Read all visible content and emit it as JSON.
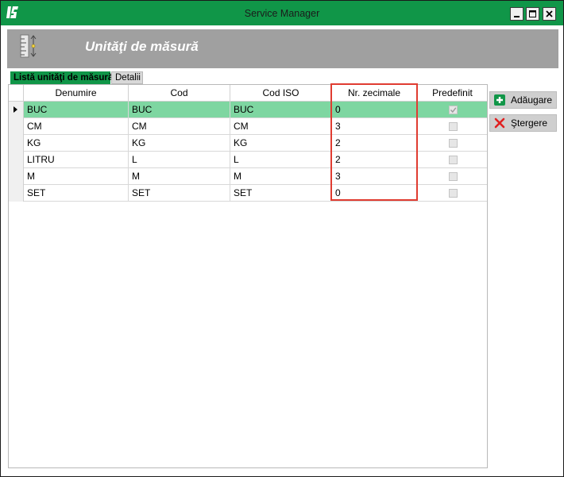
{
  "window": {
    "title": "Service Manager",
    "logo_text": "SM",
    "accent_color": "#109648",
    "selected_row_color": "#7ed6a1",
    "highlight_color": "#e03c31"
  },
  "header": {
    "title": "Unităţi de măsură",
    "icon": "ruler-icon"
  },
  "tabs": [
    {
      "label": "Listă unităţi de măsură",
      "active": true
    },
    {
      "label": "Detalii",
      "active": false
    }
  ],
  "grid": {
    "columns": [
      "Denumire",
      "Cod",
      "Cod ISO",
      "Nr. zecimale",
      "Predefinit"
    ],
    "rows": [
      {
        "denumire": "BUC",
        "cod": "BUC",
        "cod_iso": "BUC",
        "zecimale": "0",
        "predefinit": true,
        "selected": true
      },
      {
        "denumire": "CM",
        "cod": "CM",
        "cod_iso": "CM",
        "zecimale": "3",
        "predefinit": false,
        "selected": false
      },
      {
        "denumire": "KG",
        "cod": "KG",
        "cod_iso": "KG",
        "zecimale": "2",
        "predefinit": false,
        "selected": false
      },
      {
        "denumire": "LITRU",
        "cod": "L",
        "cod_iso": "L",
        "zecimale": "2",
        "predefinit": false,
        "selected": false
      },
      {
        "denumire": "M",
        "cod": "M",
        "cod_iso": "M",
        "zecimale": "3",
        "predefinit": false,
        "selected": false
      },
      {
        "denumire": "SET",
        "cod": "SET",
        "cod_iso": "SET",
        "zecimale": "0",
        "predefinit": false,
        "selected": false
      }
    ]
  },
  "actions": {
    "add_label": "Adăugare",
    "add_icon": "plus-icon",
    "delete_label": "Ştergere",
    "delete_icon": "x-icon"
  }
}
